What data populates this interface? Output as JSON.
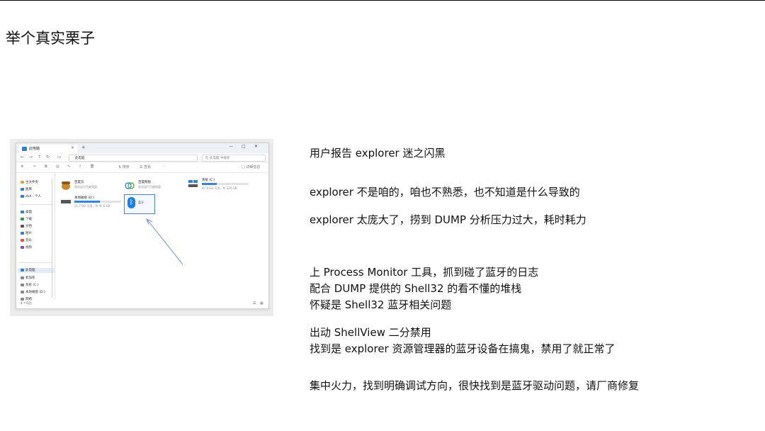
{
  "slide": {
    "title": "举个真实栗子"
  },
  "notes": [
    "用户报告 explorer 迷之闪黑",
    "explorer 不是咱的，咱也不熟悉，也不知道是什么导致的",
    "explorer 太庞大了，捞到 DUMP 分析压力过大，耗时耗力",
    "上  Process Monitor 工具，抓到碰了蓝牙的日志",
    "配合 DUMP 提供的 Shell32 的看不懂的堆栈",
    "怀疑是 Shell32 蓝牙相关问题",
    "出动 ShellView 二分禁用",
    "找到是 explorer 资源管理器的蓝牙设备在搞鬼，禁用了就正常了",
    "集中火力，找到明确调试方向，很快找到是蓝牙驱动问题，请厂商修复"
  ],
  "screenshot": {
    "tab_label": "此电脑",
    "address_text": "此电脑",
    "search_placeholder": "在 此电脑 中搜索",
    "toolbar": {
      "sort_label": "排序",
      "view_label": "查看",
      "more_label": "···",
      "details_label": "详细信息"
    },
    "sidebar": [
      {
        "label": "主文件夹",
        "color": "#e9a33a"
      },
      {
        "label": "图库",
        "color": "#2e7fd8"
      },
      {
        "label": "dxd - 个人",
        "color": "#2e7fd8"
      },
      {
        "label": "桌面",
        "color": "#2e7fd8"
      },
      {
        "label": "下载",
        "color": "#2e9b4a"
      },
      {
        "label": "文档",
        "color": "#555555"
      },
      {
        "label": "图片",
        "color": "#2e7fd8"
      },
      {
        "label": "音乐",
        "color": "#e2543f"
      },
      {
        "label": "视频",
        "color": "#7a4fc9"
      },
      {
        "label": "此电脑",
        "color": "#2e7fd8"
      },
      {
        "label": "新加卷",
        "color": "#888888"
      },
      {
        "label": "系统 (C:)",
        "color": "#888888"
      },
      {
        "label": "本地磁盘 (D:)",
        "color": "#888888"
      },
      {
        "label": "网络",
        "color": "#888888"
      }
    ],
    "items": {
      "cloud1_name": "百度云",
      "cloud1_sub": "双击运行百度网盘",
      "cloud2_name": "百度网盘",
      "cloud2_sub": "双击运行百度网盘",
      "drive_c_name": "系统 (C:)",
      "drive_c_sub": "87.8 GB 可用，共 120 GB",
      "drive_d_name": "本地磁盘 (D:)",
      "drive_d_sub": "11.7 GB 可用，共 97.6 GB",
      "bluetooth_label": "蓝牙"
    },
    "drive_c_fill": 0.32,
    "drive_d_fill": 0.55,
    "status_text": "4 个项目",
    "accent_color": "#2f86dc"
  }
}
